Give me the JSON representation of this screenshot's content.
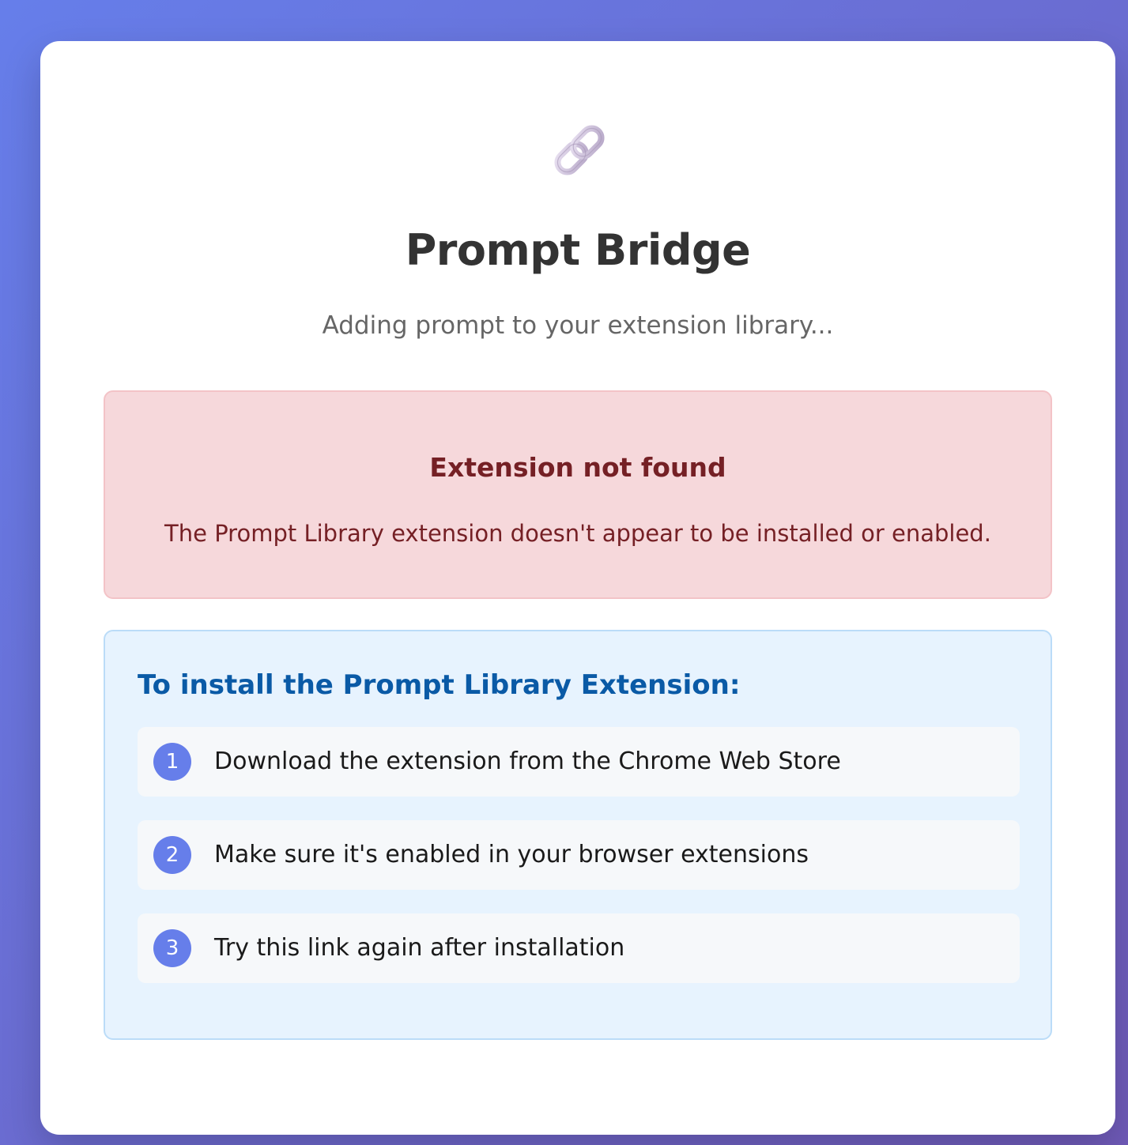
{
  "app": {
    "title": "Prompt Bridge",
    "subtitle": "Adding prompt to your extension library..."
  },
  "logo": {
    "icon": "chain-link-icon"
  },
  "error": {
    "title": "Extension not found",
    "message": "The Prompt Library extension doesn't appear to be installed or enabled."
  },
  "install": {
    "title": "To install the Prompt Library Extension:",
    "steps": [
      {
        "number": "1",
        "text": "Download the extension from the Chrome Web Store"
      },
      {
        "number": "2",
        "text": "Make sure it's enabled in your browser extensions"
      },
      {
        "number": "3",
        "text": "Try this link again after installation"
      }
    ]
  },
  "colors": {
    "background_start": "#667eea",
    "background_end": "#6f5ab8",
    "error_background": "#f6d8db",
    "error_text": "#752025",
    "info_background": "#e7f3fe",
    "info_title": "#0a5aa6",
    "step_badge": "#667eea"
  }
}
